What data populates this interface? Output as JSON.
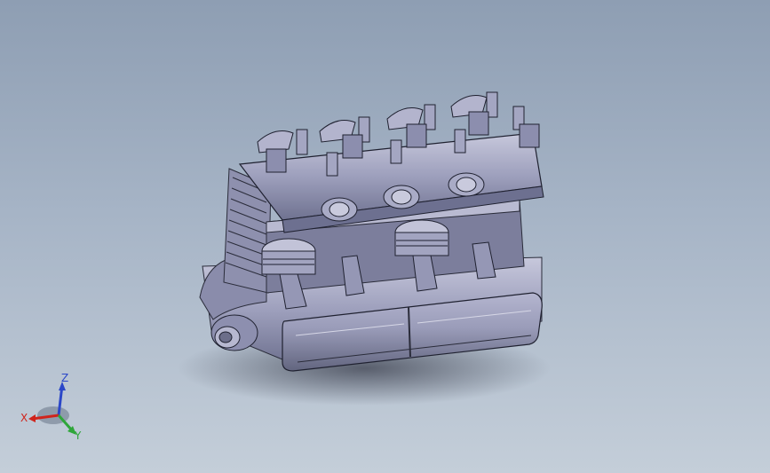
{
  "viewport": {
    "background_top": "#8e9eb3",
    "background_bottom": "#c4ced9"
  },
  "model": {
    "icon": "engine-4-cylinder-section-model",
    "body_color": "#9b9dba",
    "shadow_color": "#5c6270"
  },
  "triad": {
    "x_label": "X",
    "y_label": "Y",
    "z_label": "Z",
    "x_color": "#d0241c",
    "y_color": "#2fa63a",
    "z_color": "#2b47c8"
  }
}
